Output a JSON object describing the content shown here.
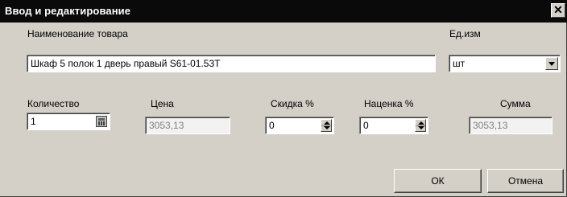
{
  "window": {
    "title": "Ввод и редактирование",
    "close_glyph": "✕"
  },
  "product": {
    "label": "Наименование товара",
    "value": "Шкаф 5 полок 1 дверь правый S61-01.53T"
  },
  "unit": {
    "label": "Ед.изм",
    "value": "шт"
  },
  "quantity": {
    "label": "Количество",
    "value": "1"
  },
  "price": {
    "label": "Цена",
    "value": "3053,13"
  },
  "discount": {
    "label": "Скидка %",
    "value": "0"
  },
  "markup": {
    "label": "Наценка %",
    "value": "0"
  },
  "total": {
    "label": "Сумма",
    "value": "3053,13"
  },
  "buttons": {
    "ok": "ОК",
    "cancel": "Отмена"
  }
}
